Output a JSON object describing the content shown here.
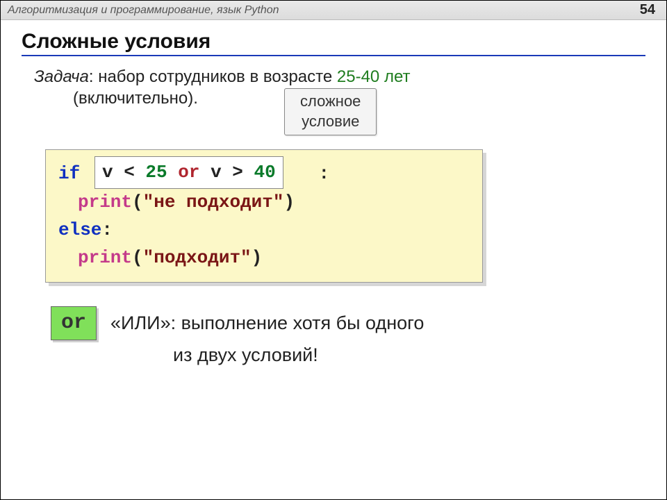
{
  "header": {
    "breadcrumb": "Алгоритмизация и программирование, язык Python",
    "page": "54"
  },
  "title": "Сложные условия",
  "task": {
    "label": "Задача",
    "text": ": набор сотрудников в возрасте ",
    "range": "25-40 лет",
    "tail": "(включительно).",
    "callout_l1": "сложное",
    "callout_l2": "условие"
  },
  "code": {
    "if": "if",
    "cond_v1": "v < ",
    "cond_25": "25",
    "cond_or": " or ",
    "cond_v2": "v > ",
    "cond_40": "40",
    "colon": ":",
    "print": "print",
    "str_ne": "\"не подходит\"",
    "else": "else",
    "str_ok": "\"подходит\""
  },
  "or_block": {
    "badge": "or",
    "line1": "«ИЛИ»: выполнение хотя бы одного",
    "line2": "из двух условий!"
  }
}
